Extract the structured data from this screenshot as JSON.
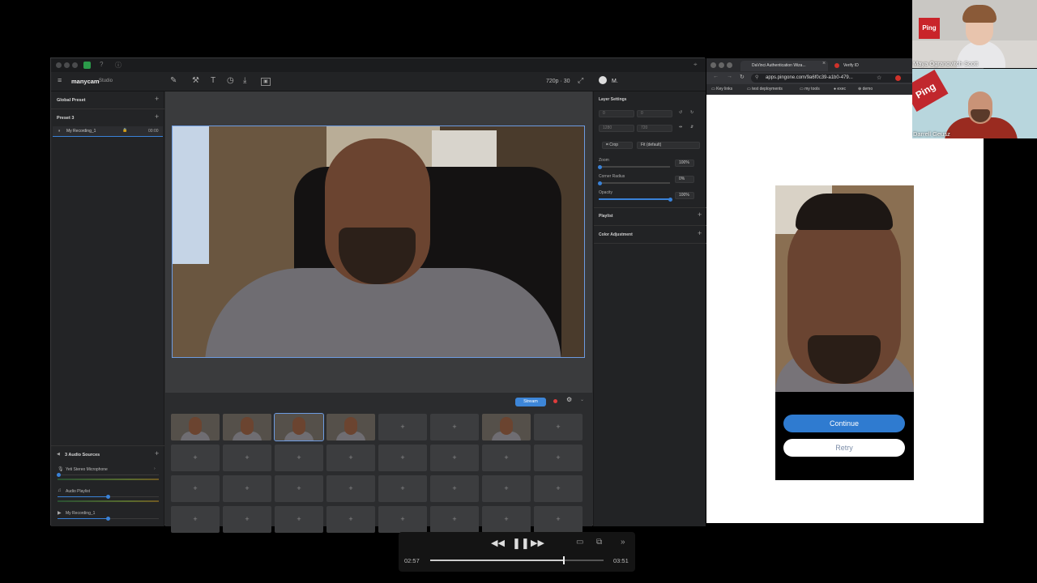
{
  "manycam": {
    "logo": "manycam",
    "logo_suffix": "Studio",
    "resolution": "720p · 30",
    "user": "M.",
    "global_preset_label": "Global Preset",
    "preset_label": "Preset 3",
    "recording_item": {
      "name": "My Recording_1",
      "time": "00:00"
    },
    "audio_sources_label": "3 Audio Sources",
    "audio_sources": [
      {
        "name": "Yeti Stereo Microphone",
        "level": 0.05
      },
      {
        "name": "Audio Playlist",
        "level": 0.5
      },
      {
        "name": "My Recording_1",
        "level": 0.5
      }
    ],
    "stream_label": "Stream",
    "layer_settings": {
      "title": "Layer Settings",
      "x": "0",
      "y": "0",
      "w": "1280",
      "h": "720",
      "crop_label": "Crop",
      "fit_value": "Fit (default)",
      "zoom_label": "Zoom",
      "zoom_value": "100%",
      "zoom_level": 0.02,
      "corner_label": "Corner Radius",
      "corner_value": "0%",
      "corner_level": 0.02,
      "opacity_label": "Opacity",
      "opacity_value": "100%",
      "opacity_level": 1.0
    },
    "playlist_label": "Playlist",
    "color_adjustment_label": "Color Adjustment",
    "grid_plus": "+"
  },
  "browser": {
    "tabs": [
      {
        "title": "DaVinci Authentication Wiza..."
      },
      {
        "title": "Verify ID"
      }
    ],
    "url": "apps.pingone.com/9a6f0c39-a1b0-479...",
    "bookmarks": [
      "Key links",
      "test deployments",
      "my tools",
      "exec",
      "demo"
    ],
    "continue_label": "Continue",
    "retry_label": "Retry"
  },
  "participants": [
    {
      "name": "Maya Ogranovitch Scott",
      "logo": "Ping"
    },
    {
      "name": "Darrell Geusz",
      "logo": "Ping"
    }
  ],
  "player": {
    "current_time": "02:57",
    "total_time": "03:51",
    "progress": 0.766
  }
}
